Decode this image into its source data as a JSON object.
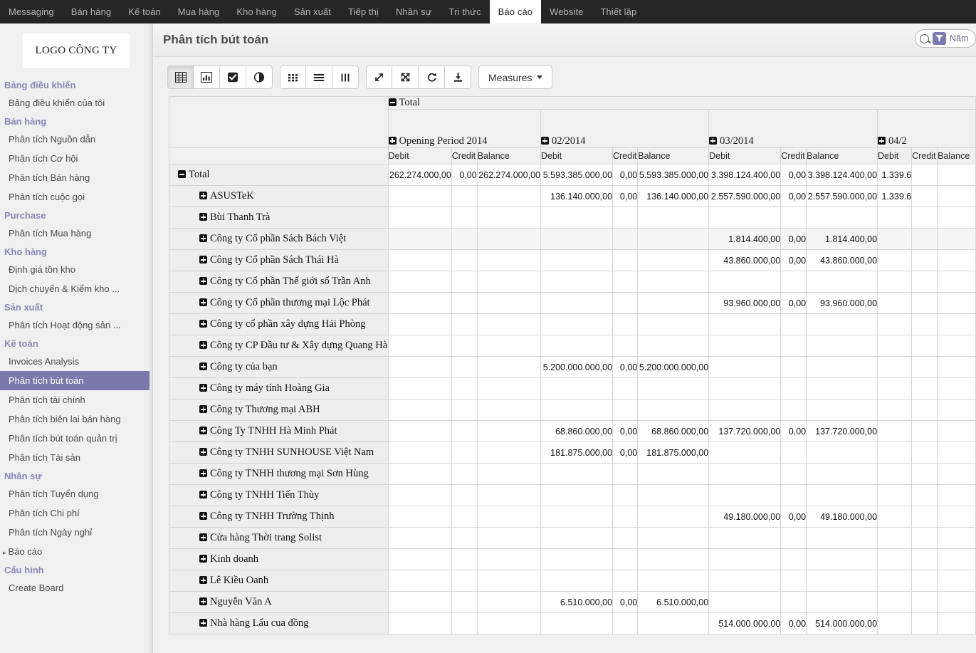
{
  "topnav": {
    "items": [
      {
        "label": "Messaging",
        "active": false
      },
      {
        "label": "Bán hàng",
        "active": false
      },
      {
        "label": "Kế toán",
        "active": false
      },
      {
        "label": "Mua hàng",
        "active": false
      },
      {
        "label": "Kho hàng",
        "active": false
      },
      {
        "label": "Sản xuất",
        "active": false
      },
      {
        "label": "Tiếp thị",
        "active": false
      },
      {
        "label": "Nhân sự",
        "active": false
      },
      {
        "label": "Tri thức",
        "active": false
      },
      {
        "label": "Báo cáo",
        "active": true
      },
      {
        "label": "Website",
        "active": false
      },
      {
        "label": "Thiết lập",
        "active": false
      }
    ]
  },
  "sidebar": {
    "logo": "LOGO CÔNG TY",
    "entries": [
      {
        "type": "group",
        "label": "Bảng điều khiển"
      },
      {
        "type": "link",
        "label": "Bảng điều khiển của tôi"
      },
      {
        "type": "group",
        "label": "Bán hàng"
      },
      {
        "type": "link",
        "label": "Phân tích Nguồn dẫn"
      },
      {
        "type": "link",
        "label": "Phân tích Cơ hội"
      },
      {
        "type": "link",
        "label": "Phân tích Bán hàng"
      },
      {
        "type": "link",
        "label": "Phân tích cuộc gọi"
      },
      {
        "type": "group",
        "label": "Purchase"
      },
      {
        "type": "link",
        "label": "Phân tích Mua hàng"
      },
      {
        "type": "group",
        "label": "Kho hàng"
      },
      {
        "type": "link",
        "label": "Định giá tồn kho"
      },
      {
        "type": "link",
        "label": "Dịch chuyển & Kiểm kho ..."
      },
      {
        "type": "group",
        "label": "Sản xuất"
      },
      {
        "type": "link",
        "label": "Phân tích Hoạt động sản ..."
      },
      {
        "type": "group",
        "label": "Kế toán"
      },
      {
        "type": "link",
        "label": "Invoices Analysis"
      },
      {
        "type": "link",
        "label": "Phân tích bút toán",
        "selected": true
      },
      {
        "type": "link",
        "label": "Phân tích tài chính"
      },
      {
        "type": "link",
        "label": "Phân tích biên lai bán hàng"
      },
      {
        "type": "link",
        "label": "Phân tích bút toán quản trị"
      },
      {
        "type": "link",
        "label": "Phân tích Tài sản"
      },
      {
        "type": "group",
        "label": "Nhân sự"
      },
      {
        "type": "link",
        "label": "Phân tích Tuyển dụng"
      },
      {
        "type": "link",
        "label": "Phân tích Chi phí"
      },
      {
        "type": "link",
        "label": "Phân tích Ngày nghỉ"
      },
      {
        "type": "link",
        "label": "Báo cáo",
        "caret": true
      },
      {
        "type": "group",
        "label": "Cấu hình"
      },
      {
        "type": "link",
        "label": "Create Board"
      }
    ]
  },
  "header": {
    "title": "Phân tích bút toán",
    "search_text": "Năm",
    "search_icon": "search-icon",
    "filter_icon": "filter-icon"
  },
  "toolbar": {
    "measures_label": "Measures",
    "groups": [
      [
        {
          "icon": "table-grid-icon",
          "pressed": true
        },
        {
          "icon": "bar-chart-icon",
          "pressed": false
        },
        {
          "icon": "checkbox-icon",
          "pressed": false
        },
        {
          "icon": "contrast-circle-icon",
          "pressed": false
        }
      ],
      [
        {
          "icon": "grid-dots-icon",
          "pressed": false
        },
        {
          "icon": "list-lines-icon",
          "pressed": false
        },
        {
          "icon": "columns-icon",
          "pressed": false
        }
      ],
      [
        {
          "icon": "expand-diagonal-icon",
          "pressed": false
        },
        {
          "icon": "collapse-arrows-icon",
          "pressed": false
        },
        {
          "icon": "refresh-icon",
          "pressed": false
        },
        {
          "icon": "download-icon",
          "pressed": false
        }
      ]
    ]
  },
  "pivot": {
    "top_header": {
      "label": "Total",
      "state": "expanded"
    },
    "measure_headers": [
      "Debit",
      "Credit",
      "Balance"
    ],
    "column_groups": [
      {
        "label": "Opening Period 2014",
        "state": "collapsed"
      },
      {
        "label": "02/2014",
        "state": "collapsed"
      },
      {
        "label": "03/2014",
        "state": "collapsed"
      },
      {
        "label": "04/2",
        "state": "collapsed",
        "truncated": true
      }
    ],
    "rows": [
      {
        "label": "Total",
        "level": 0,
        "state": "expanded",
        "shaded": false,
        "cells": [
          [
            "262.274.000,00",
            "0,00",
            "262.274.000,00"
          ],
          [
            "5.593.385.000,00",
            "0,00",
            "5.593.385.000,00"
          ],
          [
            "3.398.124.400,00",
            "0,00",
            "3.398.124.400,00"
          ],
          [
            "1.339.6",
            "",
            ""
          ]
        ]
      },
      {
        "label": "ASUSTeK",
        "level": 1,
        "state": "collapsed",
        "shaded": false,
        "cells": [
          [
            "",
            "",
            ""
          ],
          [
            "136.140.000,00",
            "0,00",
            "136.140.000,00"
          ],
          [
            "2.557.590.000,00",
            "0,00",
            "2.557.590.000,00"
          ],
          [
            "1.339.6",
            "",
            ""
          ]
        ]
      },
      {
        "label": "Bùi Thanh Trà",
        "level": 1,
        "state": "collapsed",
        "shaded": false,
        "cells": [
          [
            "",
            "",
            ""
          ],
          [
            "",
            "",
            ""
          ],
          [
            "",
            "",
            ""
          ],
          [
            "",
            "",
            ""
          ]
        ]
      },
      {
        "label": "Công ty Cổ phần Sách Bách Việt",
        "level": 1,
        "state": "collapsed",
        "shaded": true,
        "cells": [
          [
            "",
            "",
            ""
          ],
          [
            "",
            "",
            ""
          ],
          [
            "1.814.400,00",
            "0,00",
            "1.814.400,00"
          ],
          [
            "",
            "",
            ""
          ]
        ]
      },
      {
        "label": "Công ty Cổ phần Sách Thái Hà",
        "level": 1,
        "state": "collapsed",
        "shaded": false,
        "cells": [
          [
            "",
            "",
            ""
          ],
          [
            "",
            "",
            ""
          ],
          [
            "43.860.000,00",
            "0,00",
            "43.860.000,00"
          ],
          [
            "",
            "",
            ""
          ]
        ]
      },
      {
        "label": "Công ty Cổ phần Thế giới số Trần Anh",
        "level": 1,
        "state": "collapsed",
        "shaded": false,
        "cells": [
          [
            "",
            "",
            ""
          ],
          [
            "",
            "",
            ""
          ],
          [
            "",
            "",
            ""
          ],
          [
            "",
            "",
            ""
          ]
        ]
      },
      {
        "label": "Công ty Cổ phần thương mại Lộc Phát",
        "level": 1,
        "state": "collapsed",
        "shaded": false,
        "cells": [
          [
            "",
            "",
            ""
          ],
          [
            "",
            "",
            ""
          ],
          [
            "93.960.000,00",
            "0,00",
            "93.960.000,00"
          ],
          [
            "",
            "",
            ""
          ]
        ]
      },
      {
        "label": "Công ty cổ phần xây dựng Hải Phòng",
        "level": 1,
        "state": "collapsed",
        "shaded": false,
        "cells": [
          [
            "",
            "",
            ""
          ],
          [
            "",
            "",
            ""
          ],
          [
            "",
            "",
            ""
          ],
          [
            "",
            "",
            ""
          ]
        ]
      },
      {
        "label": "Công ty CP Đầu tư & Xây dựng Quang Hà",
        "level": 1,
        "state": "collapsed",
        "shaded": false,
        "cells": [
          [
            "",
            "",
            ""
          ],
          [
            "",
            "",
            ""
          ],
          [
            "",
            "",
            ""
          ],
          [
            "",
            "",
            ""
          ]
        ]
      },
      {
        "label": "Công ty của bạn",
        "level": 1,
        "state": "collapsed",
        "shaded": false,
        "cells": [
          [
            "",
            "",
            ""
          ],
          [
            "5.200.000.000,00",
            "0,00",
            "5.200.000.000,00"
          ],
          [
            "",
            "",
            ""
          ],
          [
            "",
            "",
            ""
          ]
        ]
      },
      {
        "label": "Công ty máy tính Hoàng Gia",
        "level": 1,
        "state": "collapsed",
        "shaded": false,
        "cells": [
          [
            "",
            "",
            ""
          ],
          [
            "",
            "",
            ""
          ],
          [
            "",
            "",
            ""
          ],
          [
            "",
            "",
            ""
          ]
        ]
      },
      {
        "label": "Công ty Thương mại ABH",
        "level": 1,
        "state": "collapsed",
        "shaded": false,
        "cells": [
          [
            "",
            "",
            ""
          ],
          [
            "",
            "",
            ""
          ],
          [
            "",
            "",
            ""
          ],
          [
            "",
            "",
            ""
          ]
        ]
      },
      {
        "label": "Công Ty TNHH Hà Minh Phát",
        "level": 1,
        "state": "collapsed",
        "shaded": false,
        "cells": [
          [
            "",
            "",
            ""
          ],
          [
            "68.860.000,00",
            "0,00",
            "68.860.000,00"
          ],
          [
            "137.720.000,00",
            "0,00",
            "137.720.000,00"
          ],
          [
            "",
            "",
            ""
          ]
        ]
      },
      {
        "label": "Công ty TNHH SUNHOUSE Việt Nam",
        "level": 1,
        "state": "collapsed",
        "shaded": false,
        "cells": [
          [
            "",
            "",
            ""
          ],
          [
            "181.875.000,00",
            "0,00",
            "181.875.000,00"
          ],
          [
            "",
            "",
            ""
          ],
          [
            "",
            "",
            ""
          ]
        ]
      },
      {
        "label": "Công ty TNHH thương mại Sơn Hùng",
        "level": 1,
        "state": "collapsed",
        "shaded": false,
        "cells": [
          [
            "",
            "",
            ""
          ],
          [
            "",
            "",
            ""
          ],
          [
            "",
            "",
            ""
          ],
          [
            "",
            "",
            ""
          ]
        ]
      },
      {
        "label": "Công ty TNHH Tiến Thùy",
        "level": 1,
        "state": "collapsed",
        "shaded": false,
        "cells": [
          [
            "",
            "",
            ""
          ],
          [
            "",
            "",
            ""
          ],
          [
            "",
            "",
            ""
          ],
          [
            "",
            "",
            ""
          ]
        ]
      },
      {
        "label": "Công ty TNHH Trường Thịnh",
        "level": 1,
        "state": "collapsed",
        "shaded": false,
        "cells": [
          [
            "",
            "",
            ""
          ],
          [
            "",
            "",
            ""
          ],
          [
            "49.180.000,00",
            "0,00",
            "49.180.000,00"
          ],
          [
            "",
            "",
            ""
          ]
        ]
      },
      {
        "label": "Cửa hàng Thời trang Solist",
        "level": 1,
        "state": "collapsed",
        "shaded": false,
        "cells": [
          [
            "",
            "",
            ""
          ],
          [
            "",
            "",
            ""
          ],
          [
            "",
            "",
            ""
          ],
          [
            "",
            "",
            ""
          ]
        ]
      },
      {
        "label": "Kinh doanh",
        "level": 1,
        "state": "collapsed",
        "shaded": false,
        "cells": [
          [
            "",
            "",
            ""
          ],
          [
            "",
            "",
            ""
          ],
          [
            "",
            "",
            ""
          ],
          [
            "",
            "",
            ""
          ]
        ]
      },
      {
        "label": "Lê Kiều Oanh",
        "level": 1,
        "state": "collapsed",
        "shaded": false,
        "cells": [
          [
            "",
            "",
            ""
          ],
          [
            "",
            "",
            ""
          ],
          [
            "",
            "",
            ""
          ],
          [
            "",
            "",
            ""
          ]
        ]
      },
      {
        "label": "Nguyễn Văn A",
        "level": 1,
        "state": "collapsed",
        "shaded": false,
        "cells": [
          [
            "",
            "",
            ""
          ],
          [
            "6.510.000,00",
            "0,00",
            "6.510.000,00"
          ],
          [
            "",
            "",
            ""
          ],
          [
            "",
            "",
            ""
          ]
        ]
      },
      {
        "label": "Nhà hàng Lẩu cua đồng",
        "level": 1,
        "state": "collapsed",
        "shaded": false,
        "cells": [
          [
            "",
            "",
            ""
          ],
          [
            "",
            "",
            ""
          ],
          [
            "514.000.000,00",
            "0,00",
            "514.000.000,00"
          ],
          [
            "",
            "",
            ""
          ]
        ]
      }
    ]
  },
  "colors": {
    "topbar_bg": "#262626",
    "sidebar_group": "#8a87b8",
    "selected_item_bg": "#7b78ab",
    "accent": "#7c7ab0"
  }
}
